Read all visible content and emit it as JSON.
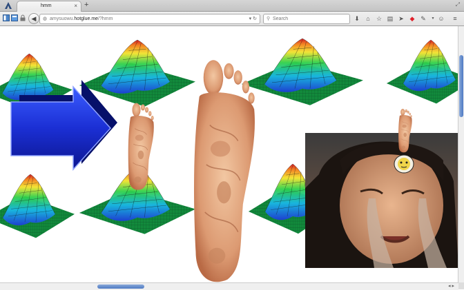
{
  "browser": {
    "tab_title": "hmm",
    "tab_close": "×",
    "new_tab": "+",
    "url_host": "amysuowu.hotglue.me",
    "url_prefix": "",
    "url_path": "/?hmm",
    "url_display_before_host": "amysuowu.",
    "url_display_host_bold": "hotglue.me",
    "search_placeholder": "Search",
    "accent": "#4d79c4"
  },
  "toolbar_icons": [
    "download-icon",
    "home-icon",
    "bookmark-star-icon",
    "library-icon",
    "share-icon",
    "stop-icon",
    "extension-icon",
    "chat-icon",
    "menu-icon"
  ],
  "page": {
    "background": "#ffffff",
    "images": [
      "surface-plot",
      "blue-arrow",
      "foot-small",
      "foot-large",
      "crying-face-photo",
      "foot-tiny",
      "moon-face"
    ]
  }
}
